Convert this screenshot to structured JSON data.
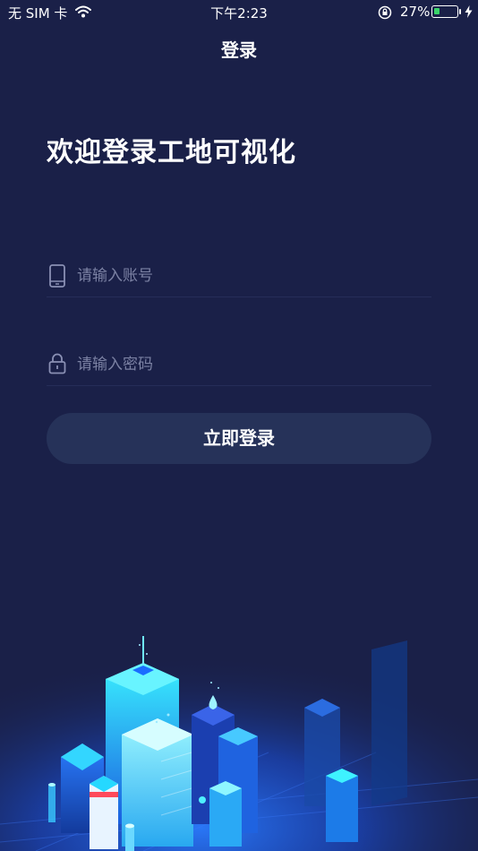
{
  "status_bar": {
    "carrier": "无 SIM 卡",
    "time": "下午2:23",
    "battery_percent": "27%",
    "battery_level": 0.27,
    "icons": [
      "wifi-icon",
      "orientation-lock-icon",
      "battery-icon",
      "charging-bolt-icon"
    ]
  },
  "nav": {
    "title": "登录"
  },
  "welcome": {
    "text": "欢迎登录工地可视化"
  },
  "form": {
    "account": {
      "placeholder": "请输入账号",
      "value": "",
      "icon": "phone-icon"
    },
    "password": {
      "placeholder": "请输入密码",
      "value": "",
      "icon": "lock-icon"
    },
    "submit_label": "立即登录"
  },
  "colors": {
    "background": "#1a2048",
    "button": "#263259",
    "placeholder": "#7b81a3",
    "accent_cyan": "#29e3ff",
    "accent_blue": "#1e6bff"
  }
}
